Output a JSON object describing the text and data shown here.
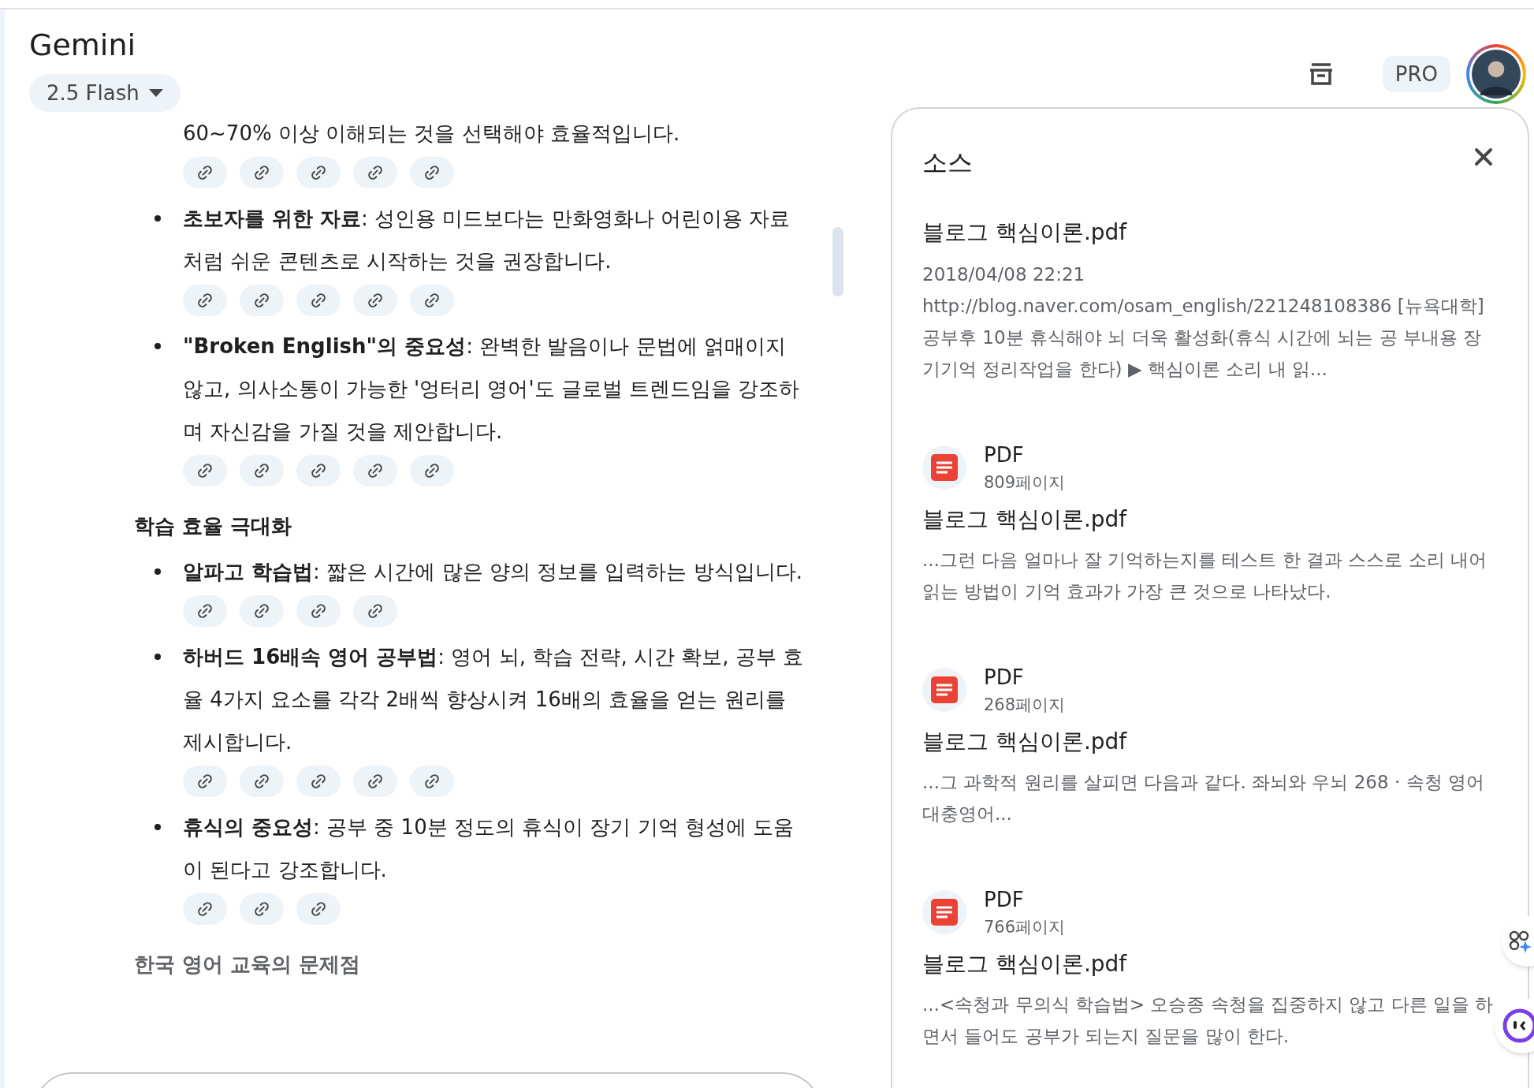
{
  "app": {
    "title": "Gemini",
    "model": "2.5 Flash",
    "badge": "PRO"
  },
  "answer": [
    {
      "kind": "paragraph",
      "bullet": false,
      "text": "60~70% 이상 이해되는 것을 선택해야 효율적입니다.",
      "citations": [
        {
          "kind": "link"
        },
        {
          "kind": "link"
        },
        {
          "kind": "link"
        },
        {
          "kind": "link"
        },
        {
          "kind": "link"
        }
      ]
    },
    {
      "kind": "paragraph",
      "bullet": true,
      "text": "**초보자를 위한 자료**: 성인용 미드보다는 만화영화나 어린이용 자료처럼 쉬운 콘텐츠로 시작하는 것을 권장합니다.",
      "citations": [
        {
          "kind": "link"
        },
        {
          "kind": "link"
        },
        {
          "kind": "link"
        },
        {
          "kind": "link"
        },
        {
          "kind": "link"
        }
      ]
    },
    {
      "kind": "paragraph",
      "bullet": true,
      "text": "**\"Broken English\"의 중요성**: 완벽한 발음이나 문법에 얽매이지 않고, 의사소통이 가능한 '엉터리 영어'도 글로벌 트렌드임을 강조하며 자신감을 가질 것을 제안합니다.",
      "citations": [
        {
          "kind": "link"
        },
        {
          "kind": "link"
        },
        {
          "kind": "link"
        },
        {
          "kind": "link"
        },
        {
          "kind": "link"
        }
      ]
    },
    {
      "kind": "heading",
      "text": "학습 효율 극대화"
    },
    {
      "kind": "paragraph",
      "bullet": true,
      "text": "**알파고 학습법**: 짧은 시간에 많은 양의 정보를 입력하는 방식입니다.",
      "citations": [
        {
          "kind": "link"
        },
        {
          "kind": "link"
        },
        {
          "kind": "link"
        },
        {
          "kind": "link"
        }
      ]
    },
    {
      "kind": "paragraph",
      "bullet": true,
      "text": "**하버드 16배속 영어 공부법**: 영어 뇌, 학습 전략, 시간 확보, 공부 효율 4가지 요소를 각각 2배씩 향상시켜 16배의 효율을 얻는 원리를 제시합니다.",
      "citations": [
        {
          "kind": "link"
        },
        {
          "kind": "link"
        },
        {
          "kind": "link"
        },
        {
          "kind": "link"
        },
        {
          "kind": "link"
        }
      ]
    },
    {
      "kind": "paragraph",
      "bullet": true,
      "text": "**휴식의 중요성**: 공부 중 10분 정도의 휴식이 장기 기억 형성에 도움이 된다고 강조합니다.",
      "citations": [
        {
          "kind": "link"
        },
        {
          "kind": "link"
        },
        {
          "kind": "link"
        }
      ]
    },
    {
      "kind": "heading",
      "text": "한국 영어 교육의 문제점"
    }
  ],
  "sources_panel": {
    "title": "소스",
    "sources": [
      {
        "kind": "web",
        "title": "블로그 핵심이론.pdf",
        "date": "2018/04/08 22:21",
        "snippet": "http://blog.naver.com/osam_english/221248108386 [뉴욕대학] 공부후 10분 휴식해야 뇌 더욱 활성화(휴식 시간에 뇌는 공 부내용 장기기억 정리작업을 한다) ▶ 핵심이론 소리 내 읽..."
      },
      {
        "kind": "pdf",
        "type": "PDF",
        "pages": "809페이지",
        "title": "블로그 핵심이론.pdf",
        "snippet": "...그런 다음 얼마나 잘 기억하는지를 테스트 한 결과 스스로 소리 내어 읽는 방법이 기억 효과가 가장 큰 것으로 나타났다."
      },
      {
        "kind": "pdf",
        "type": "PDF",
        "pages": "268페이지",
        "title": "블로그 핵심이론.pdf",
        "snippet": "...그 과학적 원리를 살피면 다음과 같다. 좌뇌와 우뇌 268 · 속청 영어 대충영어..."
      },
      {
        "kind": "pdf",
        "type": "PDF",
        "pages": "766페이지",
        "title": "블로그 핵심이론.pdf",
        "snippet": "...<속청과 무의식 학습법> 오승종 속청을 집중하지 않고 다른 일을 하면서 들어도 공부가 되는지 질문을 많이 한다."
      }
    ]
  }
}
